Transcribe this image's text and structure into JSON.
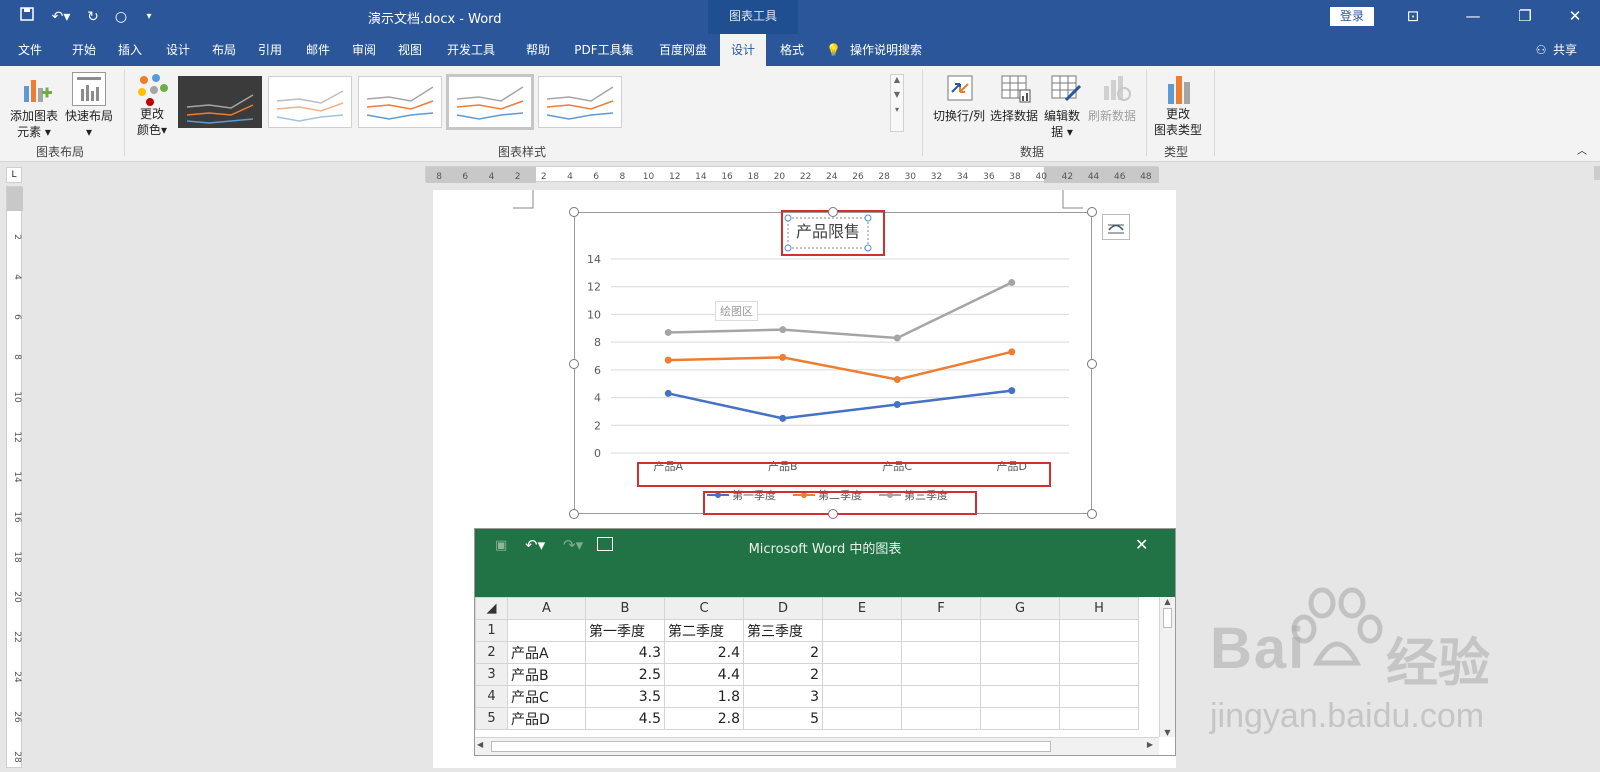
{
  "titlebar": {
    "doc_title": "演示文档.docx  -  Word",
    "tool_context": "图表工具",
    "login": "登录"
  },
  "tabs": [
    "文件",
    "开始",
    "插入",
    "设计",
    "布局",
    "引用",
    "邮件",
    "审阅",
    "视图",
    "开发工具",
    "帮助",
    "PDF工具集",
    "百度网盘",
    "设计",
    "格式"
  ],
  "active_tab_index": 13,
  "tell_me": "操作说明搜索",
  "share": "共享",
  "ribbon": {
    "add_chart_element": [
      "添加图表",
      "元素"
    ],
    "quick_layout": "快速布局",
    "group_chart_layout": "图表布局",
    "change_colors": [
      "更改",
      "颜色"
    ],
    "group_chart_styles": "图表样式",
    "switch_row_col": "切换行/列",
    "select_data": "选择数据",
    "edit_data": [
      "编辑数",
      "据"
    ],
    "refresh_data": "刷新数据",
    "group_data": "数据",
    "change_chart_type": [
      "更改",
      "图表类型"
    ],
    "group_type": "类型"
  },
  "ruler": {
    "h_ticks": [
      "8",
      "6",
      "4",
      "2",
      "2",
      "4",
      "6",
      "8",
      "10",
      "12",
      "14",
      "16",
      "18",
      "20",
      "22",
      "24",
      "26",
      "28",
      "30",
      "32",
      "34",
      "36",
      "38",
      "40",
      "42",
      "44",
      "46",
      "48"
    ],
    "v_ticks": [
      "2",
      "4",
      "6",
      "8",
      "10",
      "12",
      "14",
      "16",
      "18",
      "20",
      "22",
      "24",
      "26",
      "28"
    ]
  },
  "chart_data": {
    "type": "line",
    "title": "产品限售",
    "categories": [
      "产品A",
      "产品B",
      "产品C",
      "产品D"
    ],
    "series": [
      {
        "name": "第一季度",
        "values": [
          4.3,
          2.5,
          3.5,
          4.5
        ],
        "color": "#4472c4"
      },
      {
        "name": "第二季度",
        "values": [
          6.7,
          6.9,
          5.3,
          7.3
        ],
        "color": "#ed7d31"
      },
      {
        "name": "第三季度",
        "values": [
          8.7,
          8.9,
          8.3,
          12.3
        ],
        "color": "#a5a5a5"
      }
    ],
    "y_ticks": [
      "0",
      "2",
      "4",
      "6",
      "8",
      "10",
      "12",
      "14"
    ],
    "ylim": [
      0,
      14
    ],
    "grid": true,
    "legend": "bottom",
    "tooltip": "绘图区"
  },
  "sheet": {
    "title": "Microsoft Word 中的图表",
    "col_headers": [
      "A",
      "B",
      "C",
      "D",
      "E",
      "F",
      "G",
      "H"
    ],
    "rows": [
      {
        "n": "1",
        "cells": [
          "",
          "第一季度",
          "第二季度",
          "第三季度",
          "",
          "",
          "",
          ""
        ]
      },
      {
        "n": "2",
        "cells": [
          "产品A",
          "4.3",
          "2.4",
          "2",
          "",
          "",
          "",
          ""
        ]
      },
      {
        "n": "3",
        "cells": [
          "产品B",
          "2.5",
          "4.4",
          "2",
          "",
          "",
          "",
          ""
        ]
      },
      {
        "n": "4",
        "cells": [
          "产品C",
          "3.5",
          "1.8",
          "3",
          "",
          "",
          "",
          ""
        ]
      },
      {
        "n": "5",
        "cells": [
          "产品D",
          "4.5",
          "2.8",
          "5",
          "",
          "",
          "",
          ""
        ]
      }
    ]
  },
  "watermark": {
    "logo": "Bai",
    "logo2": "经验",
    "url": "jingyan.baidu.com"
  }
}
